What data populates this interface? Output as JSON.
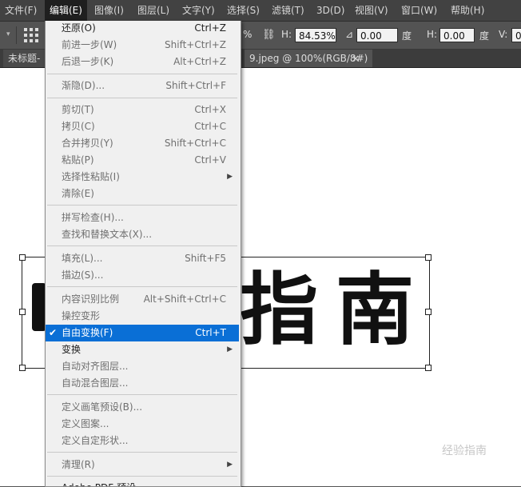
{
  "menubar": {
    "items": [
      "文件(F)",
      "编辑(E)",
      "图像(I)",
      "图层(L)",
      "文字(Y)",
      "选择(S)",
      "滤镜(T)",
      "3D(D)",
      "视图(V)",
      "窗口(W)",
      "帮助(H)"
    ],
    "active_index": 1
  },
  "options": {
    "w_value": "%",
    "h_label": "H:",
    "h_value": "84.53%",
    "angle_value": "0.00",
    "angle_unit": "度",
    "hskew_label": "H:",
    "hskew_value": "0.00",
    "hskew_unit": "度",
    "vskew_label": "V:",
    "vskew_value": "0"
  },
  "tabs": {
    "left_title": "未标题-",
    "file_title": "9.jpeg @ 100%(RGB/8#)",
    "close_glyph": "×"
  },
  "canvas": {
    "glyph_1": "指",
    "glyph_2": "南",
    "watermark": "经验指南"
  },
  "edit_menu": [
    {
      "label": "还原(O)",
      "shortcut": "Ctrl+Z",
      "state": "enabled"
    },
    {
      "label": "前进一步(W)",
      "shortcut": "Shift+Ctrl+Z",
      "state": "disabled"
    },
    {
      "label": "后退一步(K)",
      "shortcut": "Alt+Ctrl+Z",
      "state": "disabled"
    },
    {
      "label": "渐隐(D)...",
      "shortcut": "Shift+Ctrl+F",
      "state": "disabled"
    },
    {
      "label": "剪切(T)",
      "shortcut": "Ctrl+X",
      "state": "disabled"
    },
    {
      "label": "拷贝(C)",
      "shortcut": "Ctrl+C",
      "state": "disabled"
    },
    {
      "label": "合并拷贝(Y)",
      "shortcut": "Shift+Ctrl+C",
      "state": "disabled"
    },
    {
      "label": "粘贴(P)",
      "shortcut": "Ctrl+V",
      "state": "disabled"
    },
    {
      "label": "选择性粘贴(I)",
      "shortcut": "",
      "state": "disabled"
    },
    {
      "label": "清除(E)",
      "shortcut": "",
      "state": "disabled"
    },
    {
      "label": "拼写检查(H)...",
      "shortcut": "",
      "state": "disabled"
    },
    {
      "label": "查找和替换文本(X)...",
      "shortcut": "",
      "state": "disabled"
    },
    {
      "label": "填充(L)...",
      "shortcut": "Shift+F5",
      "state": "disabled"
    },
    {
      "label": "描边(S)...",
      "shortcut": "",
      "state": "disabled"
    },
    {
      "label": "内容识别比例",
      "shortcut": "Alt+Shift+Ctrl+C",
      "state": "disabled"
    },
    {
      "label": "操控变形",
      "shortcut": "",
      "state": "disabled"
    },
    {
      "label": "自由变换(F)",
      "shortcut": "Ctrl+T",
      "state": "checked"
    },
    {
      "label": "变换",
      "shortcut": "",
      "state": "enabled"
    },
    {
      "label": "自动对齐图层...",
      "shortcut": "",
      "state": "disabled"
    },
    {
      "label": "自动混合图层...",
      "shortcut": "",
      "state": "disabled"
    },
    {
      "label": "定义画笔预设(B)...",
      "shortcut": "",
      "state": "disabled"
    },
    {
      "label": "定义图案...",
      "shortcut": "",
      "state": "disabled"
    },
    {
      "label": "定义自定形状...",
      "shortcut": "",
      "state": "disabled"
    },
    {
      "label": "清理(R)",
      "shortcut": "",
      "state": "disabled"
    },
    {
      "label": "Adobe PDF 预设...",
      "shortcut": "",
      "state": "enabled"
    }
  ],
  "colors": {
    "highlight": "#0a6fd6",
    "menubar_bg": "#424242"
  }
}
